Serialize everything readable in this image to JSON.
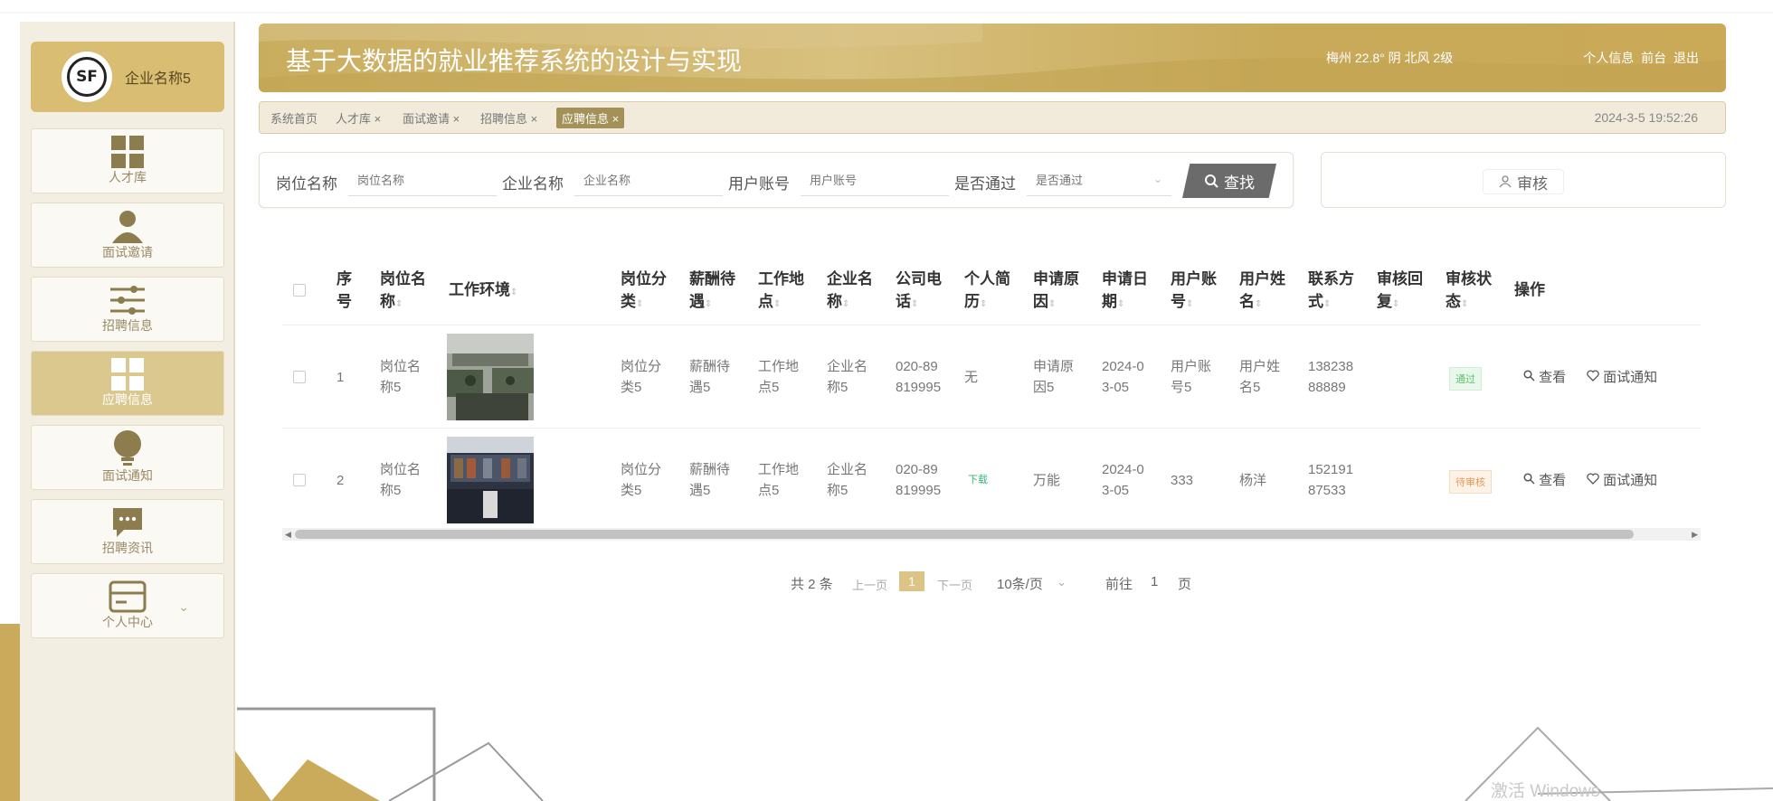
{
  "app": {
    "title": "基于大数据的就业推荐系统的设计与实现",
    "weather": "梅州 22.8° 阴 北风 2级"
  },
  "header_links": [
    "个人信息",
    "前台",
    "退出"
  ],
  "company": {
    "name": "企业名称5",
    "logo_text": "SF"
  },
  "sidebar": {
    "items": [
      {
        "label": "人才库",
        "icon": "grid-icon"
      },
      {
        "label": "面试邀请",
        "icon": "user-icon"
      },
      {
        "label": "招聘信息",
        "icon": "sliders-icon"
      },
      {
        "label": "应聘信息",
        "icon": "grid-icon",
        "active": true
      },
      {
        "label": "面试通知",
        "icon": "lightbulb-icon"
      },
      {
        "label": "招聘资讯",
        "icon": "chat-icon"
      },
      {
        "label": "个人中心",
        "icon": "card-icon"
      }
    ]
  },
  "tabs": [
    {
      "label": "系统首页"
    },
    {
      "label": "人才库 ×"
    },
    {
      "label": "面试邀请 ×"
    },
    {
      "label": "招聘信息 ×"
    },
    {
      "label": "应聘信息 ×",
      "active": true
    }
  ],
  "timestamp": "2024-3-5 19:52:26",
  "search": {
    "fields": [
      {
        "label": "岗位名称",
        "placeholder": "岗位名称"
      },
      {
        "label": "企业名称",
        "placeholder": "企业名称"
      },
      {
        "label": "用户账号",
        "placeholder": "用户账号"
      },
      {
        "label": "是否通过",
        "placeholder": "是否通过"
      }
    ],
    "button": "查找",
    "audit_button": "审核"
  },
  "table": {
    "headers": [
      {
        "l1": "序",
        "l2": "号"
      },
      {
        "l1": "岗位名",
        "l2": "称"
      },
      {
        "l1": "工作环境",
        "l2": ""
      },
      {
        "l1": "岗位分",
        "l2": "类"
      },
      {
        "l1": "薪酬待",
        "l2": "遇"
      },
      {
        "l1": "工作地",
        "l2": "点"
      },
      {
        "l1": "企业名",
        "l2": "称"
      },
      {
        "l1": "公司电",
        "l2": "话"
      },
      {
        "l1": "个人简",
        "l2": "历"
      },
      {
        "l1": "申请原",
        "l2": "因"
      },
      {
        "l1": "申请日",
        "l2": "期"
      },
      {
        "l1": "用户账",
        "l2": "号"
      },
      {
        "l1": "用户姓",
        "l2": "名"
      },
      {
        "l1": "联系方",
        "l2": "式"
      },
      {
        "l1": "审核回",
        "l2": "复"
      },
      {
        "l1": "审核状",
        "l2": "态"
      },
      {
        "l1": "操作",
        "l2": ""
      }
    ],
    "rows": [
      {
        "idx": "1",
        "job_name": [
          "岗位名",
          "称5"
        ],
        "category": [
          "岗位分",
          "类5"
        ],
        "salary": [
          "薪酬待",
          "遇5"
        ],
        "location": [
          "工作地",
          "点5"
        ],
        "company": [
          "企业名",
          "称5"
        ],
        "phone": [
          "020-89",
          "819995"
        ],
        "resume": "无",
        "reason": [
          "申请原",
          "因5"
        ],
        "date": [
          "2024-0",
          "3-05"
        ],
        "account": [
          "用户账",
          "号5"
        ],
        "username": [
          "用户姓",
          "名5"
        ],
        "contact": [
          "138238",
          "88889"
        ],
        "reply": "",
        "status": "通过",
        "ops": [
          "查看",
          "面试通知"
        ]
      },
      {
        "idx": "2",
        "job_name": [
          "岗位名",
          "称5"
        ],
        "category": [
          "岗位分",
          "类5"
        ],
        "salary": [
          "薪酬待",
          "遇5"
        ],
        "location": [
          "工作地",
          "点5"
        ],
        "company": [
          "企业名",
          "称5"
        ],
        "phone": [
          "020-89",
          "819995"
        ],
        "resume": "下载",
        "reason": [
          "万能",
          ""
        ],
        "date": [
          "2024-0",
          "3-05"
        ],
        "account": [
          "333",
          ""
        ],
        "username": [
          "杨洋",
          ""
        ],
        "contact": [
          "152191",
          "87533"
        ],
        "reply": "",
        "status": "待审核",
        "ops": [
          "查看",
          "面试通知"
        ]
      }
    ]
  },
  "pagination": {
    "total": "共 2 条",
    "prev": "上一页",
    "current": "1",
    "next": "下一页",
    "size": "10条/页",
    "goto": "前往",
    "page_input": "1",
    "page_unit": "页"
  },
  "watermark": "激活 Windows",
  "colors": {
    "gold": "#c9ad5f",
    "active": "#dbc88f",
    "search_btn": "#6b6b6b"
  }
}
